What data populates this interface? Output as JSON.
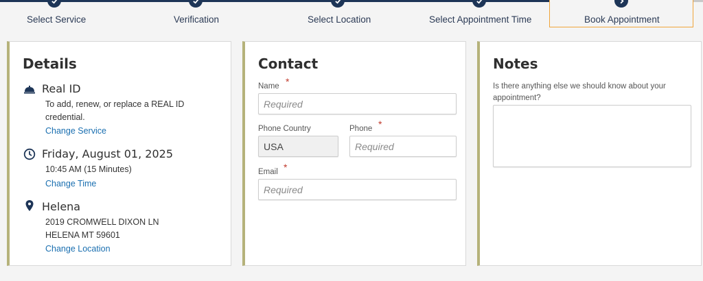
{
  "stepper": {
    "steps": [
      {
        "label": "Select Service"
      },
      {
        "label": "Verification"
      },
      {
        "label": "Select Location"
      },
      {
        "label": "Select Appointment Time"
      },
      {
        "label": "Book Appointment"
      }
    ]
  },
  "details": {
    "title": "Details",
    "service": {
      "title": "Real ID",
      "line1": "To add, renew, or replace a REAL ID",
      "line2": "credential.",
      "link": "Change Service",
      "icon": "service-bell-icon"
    },
    "time": {
      "title": "Friday, August 01, 2025",
      "line1": "10:45 AM (15 Minutes)",
      "link": "Change Time",
      "icon": "clock-icon"
    },
    "location": {
      "title": "Helena",
      "line1": "2019 CROMWELL DIXON LN",
      "line2": "HELENA MT 59601",
      "link": "Change Location",
      "icon": "map-pin-icon"
    }
  },
  "contact": {
    "title": "Contact",
    "name_label": "Name",
    "name_placeholder": "Required",
    "phone_country_label": "Phone Country",
    "phone_country_value": "USA",
    "phone_label": "Phone",
    "phone_placeholder": "Required",
    "email_label": "Email",
    "email_placeholder": "Required",
    "required_mark": "*"
  },
  "notes": {
    "title": "Notes",
    "prompt_line1": "Is there anything else we should know about your",
    "prompt_line2": "appointment?",
    "value": ""
  },
  "colors": {
    "primary": "#1d3557",
    "link": "#1a6fb0",
    "accent_border": "#b5b27a",
    "active_step": "#f0a43a",
    "required": "#c0392b"
  }
}
